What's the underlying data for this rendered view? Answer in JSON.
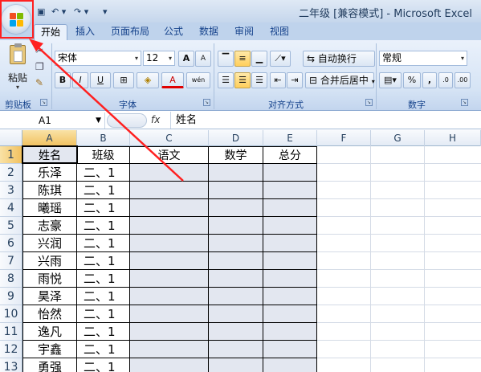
{
  "window": {
    "title": "二年级  [兼容模式] - Microsoft Excel"
  },
  "quick_access": {
    "save": "▣",
    "undo": "↶ ▾",
    "redo": "↷ ▾",
    "customize": "▾"
  },
  "tabs": [
    {
      "label": "开始",
      "active": true
    },
    {
      "label": "插入"
    },
    {
      "label": "页面布局"
    },
    {
      "label": "公式"
    },
    {
      "label": "数据"
    },
    {
      "label": "审阅"
    },
    {
      "label": "视图"
    }
  ],
  "ribbon": {
    "clipboard": {
      "paste_label": "粘贴",
      "group_label": "剪贴板"
    },
    "font": {
      "name": "宋体",
      "size": "12",
      "grow": "A",
      "shrink": "A",
      "bold": "B",
      "italic": "I",
      "underline": "U",
      "border": "⊞",
      "fill": "◈",
      "color": "A",
      "extra": "wén",
      "group_label": "字体"
    },
    "alignment": {
      "wrap_label": "自动换行",
      "merge_label": "合并后居中",
      "group_label": "对齐方式"
    },
    "number": {
      "format": "常规",
      "percent": "%",
      "comma": ",",
      "inc_dec": ".0",
      "dec_dec": ".00",
      "group_label": "数字"
    }
  },
  "formula_bar": {
    "name_box": "A1",
    "fx": "fx",
    "content": "姓名"
  },
  "grid": {
    "columns": [
      "A",
      "B",
      "C",
      "D",
      "E",
      "F",
      "G",
      "H"
    ],
    "selected_column": "A",
    "selected_row": 1,
    "header_row": [
      "姓名",
      "班级",
      "语文",
      "数学",
      "总分"
    ],
    "rows": [
      {
        "n": "2",
        "name": "乐泽",
        "cls": "二、1"
      },
      {
        "n": "3",
        "name": "陈琪",
        "cls": "二、1"
      },
      {
        "n": "4",
        "name": "曦瑶",
        "cls": "二、1"
      },
      {
        "n": "5",
        "name": "志豪",
        "cls": "二、1"
      },
      {
        "n": "6",
        "name": "兴润",
        "cls": "二、1"
      },
      {
        "n": "7",
        "name": "兴雨",
        "cls": "二、1"
      },
      {
        "n": "8",
        "name": "雨悦",
        "cls": "二、1"
      },
      {
        "n": "9",
        "name": "昊泽",
        "cls": "二、1"
      },
      {
        "n": "10",
        "name": "怡然",
        "cls": "二、1"
      },
      {
        "n": "11",
        "name": "逸凡",
        "cls": "二、1"
      },
      {
        "n": "12",
        "name": "宇鑫",
        "cls": "二、1"
      },
      {
        "n": "13",
        "name": "勇强",
        "cls": "二、1"
      }
    ]
  },
  "annotation_color": "#ff2020"
}
